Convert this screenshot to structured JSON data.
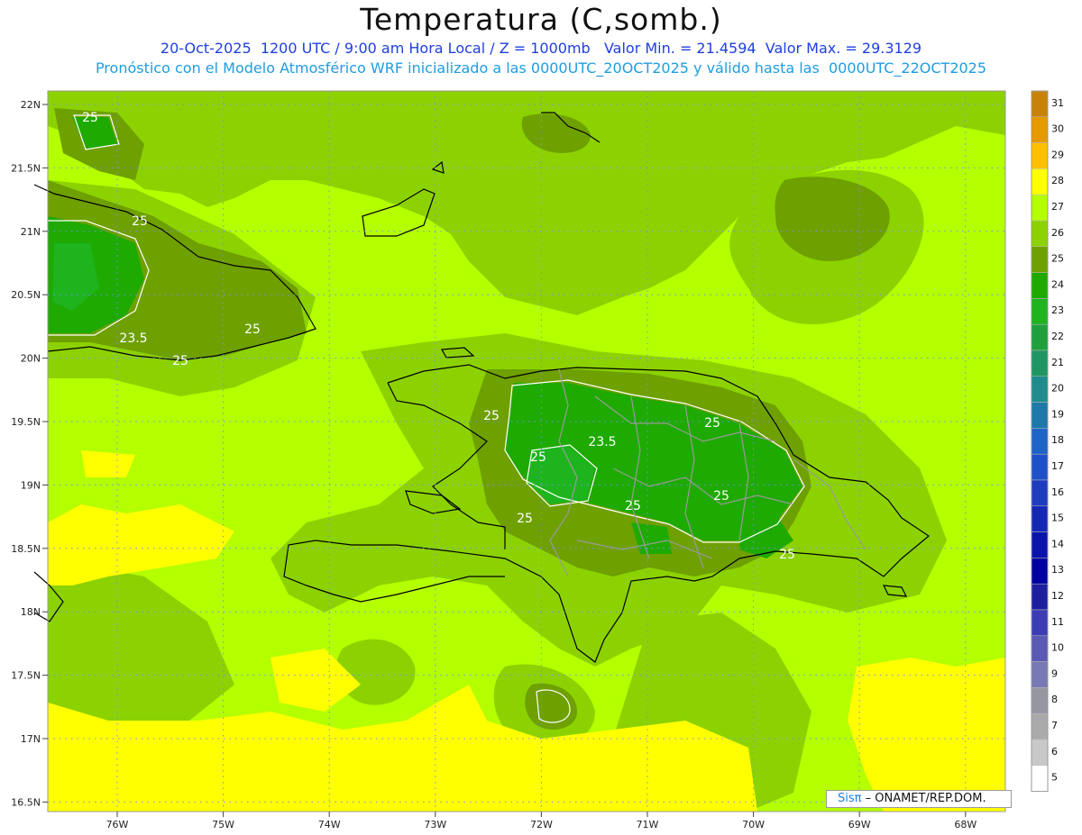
{
  "header": {
    "title": "Temperatura (C,somb.)",
    "subtitle_line1": "20-Oct-2025  1200 UTC / 9:00 am Hora Local / Z = 1000mb   Valor Min. = 21.4594  Valor Max. = 29.3129",
    "subtitle_line2": "Pronóstico con el Modelo Atmosférico WRF inicializado a las 0000UTC_20OCT2025 y válido hasta las  0000UTC_22OCT2025"
  },
  "axes": {
    "lat_labels": [
      "22N",
      "21.5N",
      "21N",
      "20.5N",
      "20N",
      "19.5N",
      "19N",
      "18.5N",
      "18N",
      "17.5N",
      "17N",
      "16.5N"
    ],
    "lon_labels": [
      "76W",
      "75W",
      "74W",
      "73W",
      "72W",
      "71W",
      "70W",
      "69W",
      "68W"
    ]
  },
  "colorbar": {
    "levels": [
      "31",
      "30",
      "29",
      "28",
      "27",
      "26",
      "25",
      "24",
      "23",
      "22",
      "21",
      "20",
      "19",
      "18",
      "17",
      "16",
      "15",
      "14",
      "13",
      "12",
      "11",
      "10",
      "9",
      "8",
      "7",
      "6",
      "5"
    ],
    "colors": [
      "#c8820a",
      "#e69a00",
      "#ffc000",
      "#ffff00",
      "#b4ff00",
      "#8cd200",
      "#6ea000",
      "#1eaa00",
      "#1eb41e",
      "#1ea03c",
      "#1e9664",
      "#1e8c8c",
      "#1e78aa",
      "#1e64c8",
      "#1e50c8",
      "#1e3cbe",
      "#1428b4",
      "#0a14aa",
      "#0000a0",
      "#1e1ea0",
      "#3c3cb4",
      "#5a5ab4",
      "#7878b4",
      "#9696a0",
      "#aaaaaa",
      "#c8c8c8",
      "#ffffff"
    ]
  },
  "map_colors": {
    "t28": "#ffff00",
    "t27": "#b4ff00",
    "t26": "#8cd200",
    "t25": "#6ea000",
    "t24": "#1eaa00",
    "t23": "#1eb41e",
    "t22": "#1ea03c"
  },
  "contour_labels": [
    "25",
    "23.5",
    "25",
    "25",
    "25",
    "25",
    "23.5",
    "25",
    "25",
    "25",
    "25",
    "25",
    "25"
  ],
  "credit": {
    "brand": "Sisπ",
    "text": " – ONAMET/REP.DOM."
  }
}
